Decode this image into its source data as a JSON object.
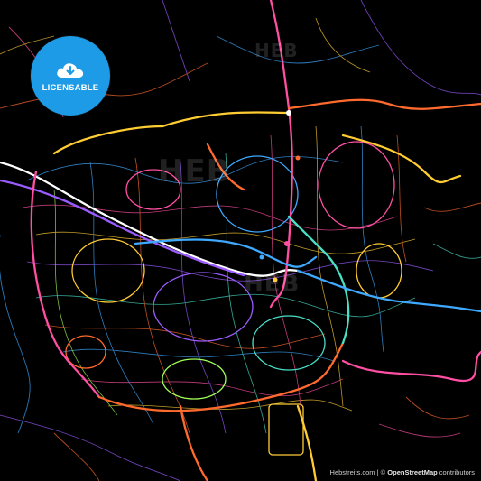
{
  "badge": {
    "label": "LICENSABLE",
    "color": "#1e9be6",
    "icon": "cloud-download-icon"
  },
  "watermarks": {
    "top": "HEB",
    "mid": "HEB",
    "low": "HEB"
  },
  "credit": {
    "site": "Hebstreits.com",
    "separator": " | © ",
    "osm": "OpenStreetMap",
    "suffix": " contributors"
  },
  "map": {
    "background": "#000000",
    "road_colors": [
      "#ff6a2e",
      "#ffcc33",
      "#3fa9ff",
      "#ff4fa3",
      "#9b5cff",
      "#49e0c8",
      "#a0ff5a",
      "#ffffff"
    ]
  }
}
